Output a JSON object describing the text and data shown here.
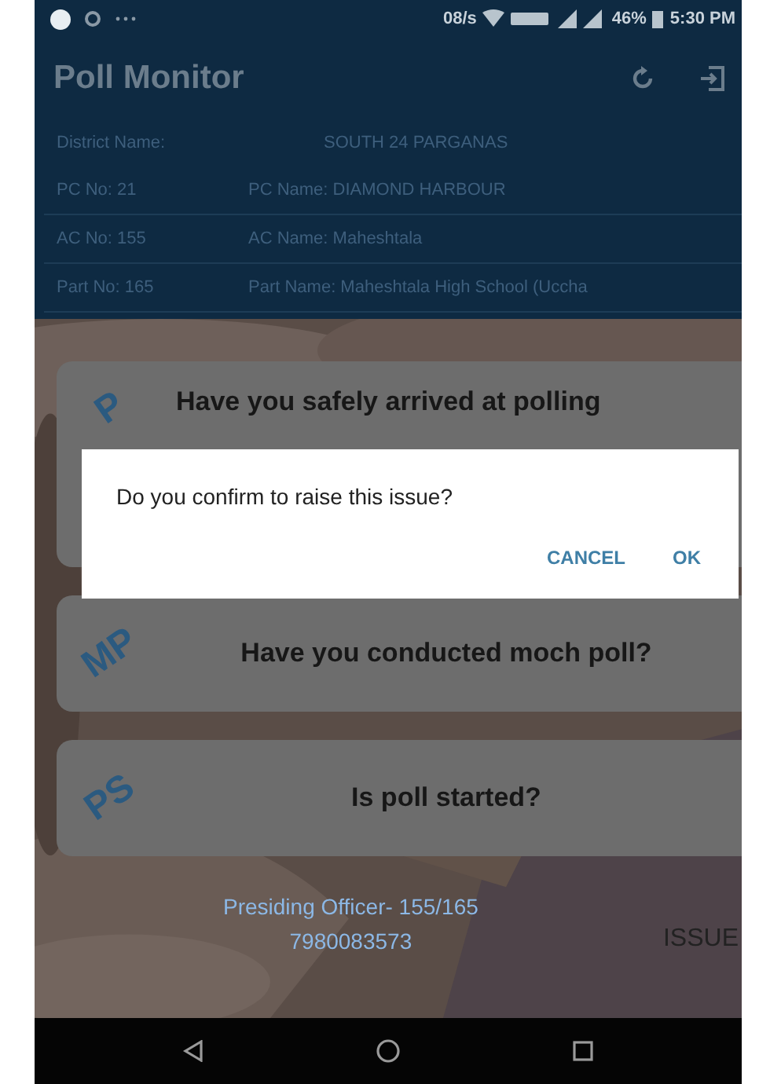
{
  "status_bar": {
    "speed": "08/s",
    "battery": "46%",
    "time": "5:30 PM"
  },
  "app_bar": {
    "title": "Poll Monitor"
  },
  "info_rows": [
    {
      "cells": [
        "District Name:",
        "SOUTH 24 PARGANAS"
      ]
    },
    {
      "cells": [
        "PC No: 21",
        "PC Name: DIAMOND HARBOUR"
      ]
    },
    {
      "cells": [
        "AC No: 155",
        "AC Name: Maheshtala"
      ]
    },
    {
      "cells": [
        "Part No: 165",
        "Part Name: Maheshtala High School (Uccha"
      ]
    }
  ],
  "cards": [
    {
      "badge": "P",
      "question": "Have you safely arrived at polling"
    },
    {
      "badge": "MP",
      "question": "Have you conducted moch poll?"
    },
    {
      "badge": "PS",
      "question": "Is poll started?"
    }
  ],
  "footer": {
    "officer": "Presiding Officer- 155/165",
    "phone": "7980083573",
    "issue_button": "ISSUE"
  },
  "dialog": {
    "message": "Do you confirm to raise this issue?",
    "buttons": [
      "CANCEL",
      "OK"
    ]
  }
}
